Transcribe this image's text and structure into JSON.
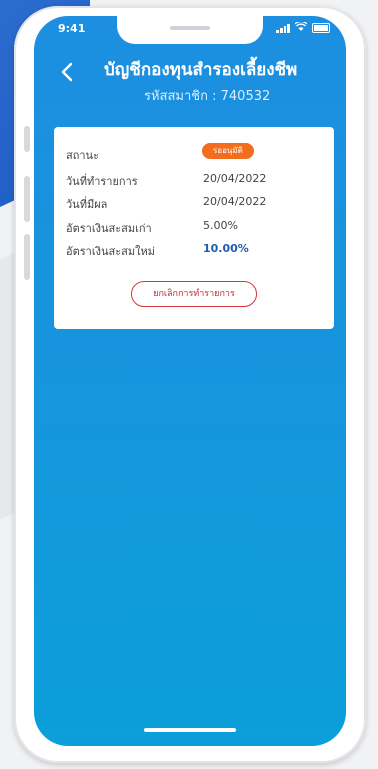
{
  "status_bar": {
    "time": "9:41"
  },
  "header": {
    "title": "บัญชีกองทุนสำรองเลี้ยงชีพ",
    "subtitle": "รหัสสมาชิก : 740532"
  },
  "details": {
    "status": {
      "label": "สถานะ",
      "badge": "รออนุมัติ"
    },
    "transaction_date": {
      "label": "วันที่ทำรายการ",
      "value": "20/04/2022"
    },
    "effective_date": {
      "label": "วันที่มีผล",
      "value": "20/04/2022"
    },
    "old_rate": {
      "label": "อัตราเงินสะสมเก่า",
      "value": "5.00%"
    },
    "new_rate": {
      "label": "อัตราเงินสะสมใหม่",
      "value": "10.00%"
    },
    "cancel_button": "ยกเลิกการทำรายการ"
  },
  "colors": {
    "screen_gradient_top": "#1d8fe0",
    "screen_gradient_bottom": "#0b9fd9",
    "badge": "#f26d1d",
    "cancel": "#d8333a",
    "highlight_value": "#1c5db0"
  },
  "icons": {
    "back": "chevron-left-icon",
    "signal": "signal-icon",
    "wifi": "wifi-icon",
    "battery": "battery-icon"
  }
}
